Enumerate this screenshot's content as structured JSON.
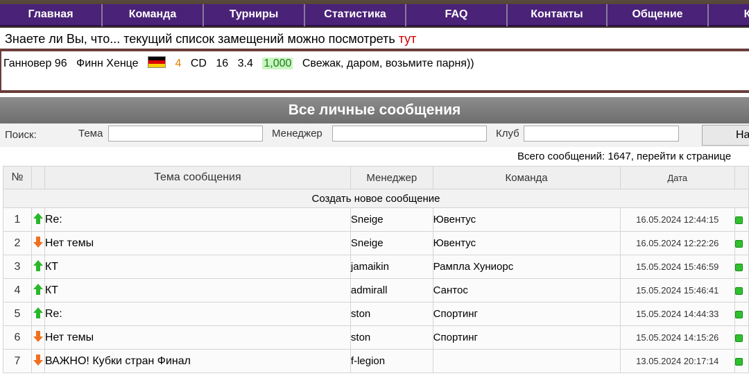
{
  "nav": {
    "items": [
      "Главная",
      "Команда",
      "Турниры",
      "Статистика",
      "FAQ",
      "Контакты",
      "Общение",
      "Ка"
    ]
  },
  "tip": {
    "text": "Знаете ли Вы, что... текущий список замещений можно посмотреть ",
    "link": "тут"
  },
  "transfer": {
    "club": "Ганновер 96",
    "player": "Финн Хенце",
    "age": "4",
    "position": "CD",
    "value1": "16",
    "value2": "3.4",
    "price": "1,000",
    "comment": "Свежак, даром, возьмите парня))"
  },
  "header": {
    "title": "Все личные сообщения"
  },
  "search": {
    "label": "Поиск:",
    "topic_label": "Тема",
    "manager_label": "Менеджер",
    "club_label": "Клуб",
    "button_label": "На"
  },
  "summary": {
    "text": "Всего сообщений: 1647, перейти к странице"
  },
  "table": {
    "new_message": "Создать новое сообщение",
    "headers": {
      "num": "№",
      "subject": "Тема сообщения",
      "manager": "Менеджер",
      "team": "Команда",
      "date": "Дата"
    },
    "rows": [
      {
        "num": "1",
        "dir": "up",
        "subject": "Re:",
        "manager": "Sneige",
        "team": "Ювентус",
        "date": "16.05.2024 12:44:15"
      },
      {
        "num": "2",
        "dir": "down",
        "subject": "Нет темы",
        "manager": "Sneige",
        "team": "Ювентус",
        "date": "16.05.2024 12:22:26"
      },
      {
        "num": "3",
        "dir": "up",
        "subject": "КТ",
        "manager": "jamaikin",
        "team": "Рампла Хуниорс",
        "date": "15.05.2024 15:46:59"
      },
      {
        "num": "4",
        "dir": "up",
        "subject": "КТ",
        "manager": "admirall",
        "team": "Сантос",
        "date": "15.05.2024 15:46:41"
      },
      {
        "num": "5",
        "dir": "up",
        "subject": "Re:",
        "manager": "ston",
        "team": "Спортинг",
        "date": "15.05.2024 14:44:33"
      },
      {
        "num": "6",
        "dir": "down",
        "subject": "Нет темы",
        "manager": "ston",
        "team": "Спортинг",
        "date": "15.05.2024 14:15:26"
      },
      {
        "num": "7",
        "dir": "down",
        "subject": "ВАЖНО! Кубки стран Финал",
        "manager": "f-legion",
        "team": "",
        "date": "13.05.2024 20:17:14"
      }
    ]
  },
  "colors": {
    "nav_bg": "#4a2278",
    "link_red": "#d00000",
    "up_arrow": "#29b829",
    "down_arrow": "#f07020"
  }
}
